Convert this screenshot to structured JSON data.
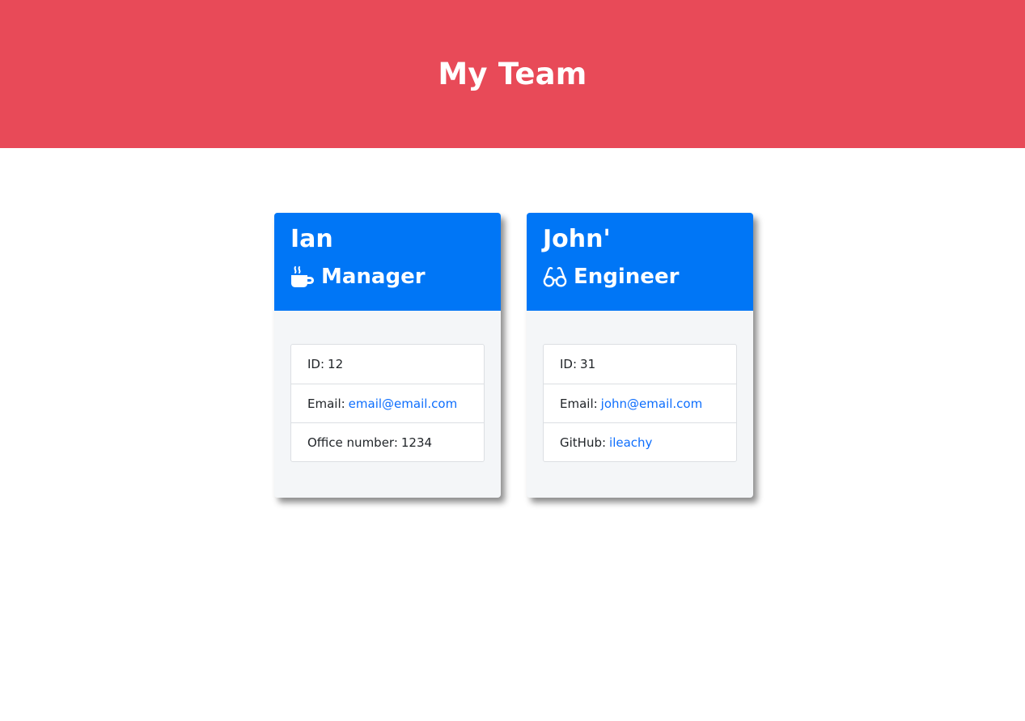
{
  "header": {
    "title": "My Team"
  },
  "accent_colors": {
    "hero": "#e84a58",
    "card_header": "#0076f6",
    "link": "#0d6efd"
  },
  "cards": [
    {
      "name": "Ian",
      "role": "Manager",
      "role_icon": "coffee-cup-icon",
      "id_label": "ID:",
      "id": "12",
      "email_label": "Email:",
      "email": "email@email.com",
      "extra_label": "Office number:",
      "extra_value": "1234"
    },
    {
      "name": "John'",
      "role": "Engineer",
      "role_icon": "glasses-icon",
      "id_label": "ID:",
      "id": "31",
      "email_label": "Email:",
      "email": "john@email.com",
      "extra_label": "GitHub:",
      "extra_value": "ileachy"
    }
  ]
}
